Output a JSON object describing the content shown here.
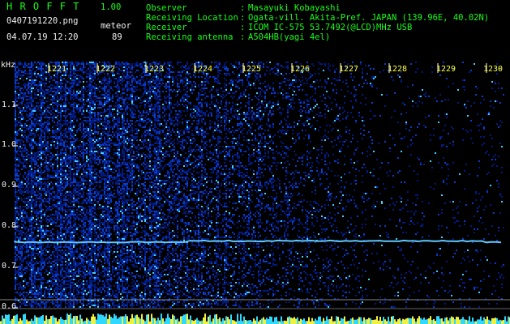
{
  "app": {
    "name": "H R O F F T",
    "version": "1.00"
  },
  "file": {
    "name": "0407191220.png",
    "datetime": "04.07.19 12:20"
  },
  "meteor": {
    "label": "meteor",
    "count": "89"
  },
  "info": [
    {
      "key": "Observer",
      "sep": ":",
      "value": "Masayuki Kobayashi"
    },
    {
      "key": "Receiving Location",
      "sep": ":",
      "value": "Ogata-vill. Akita-Pref. JAPAN (139.96E, 40.02N)"
    },
    {
      "key": "Receiver",
      "sep": ":",
      "value": "ICOM IC-575 53.7492(@LCD)MHz USB"
    },
    {
      "key": "Receiving antenna",
      "sep": ":",
      "value": "A504HB(yagi 4el)"
    }
  ],
  "axis": {
    "unit": "kHz",
    "freq_ticks": [
      "1.1",
      "1.0",
      "0.9",
      "0.8",
      "0.7",
      "0.6"
    ],
    "time_ticks": [
      "1221",
      "1222",
      "1223",
      "1224",
      "1225",
      "1226",
      "1227",
      "1228",
      "1229",
      "1230"
    ]
  },
  "colors": {
    "background": "#000000",
    "header_text": "#18ff18",
    "time_tick_text": "#ffff40",
    "carrier_line": "#60c8ff",
    "noise_low": "#001a80",
    "noise_high": "#40d0ff"
  }
}
